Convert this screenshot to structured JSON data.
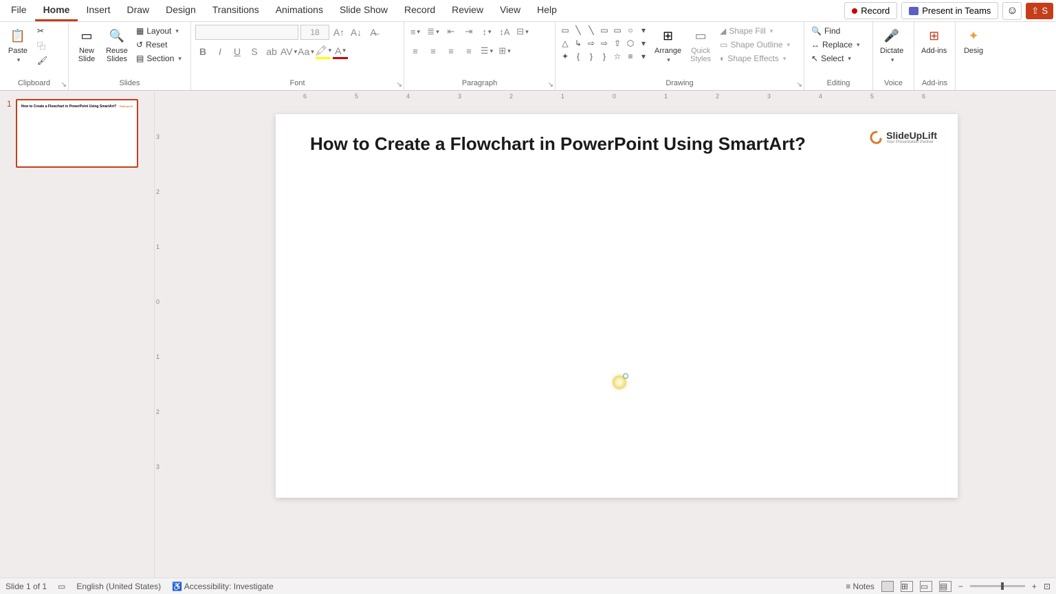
{
  "tabs": {
    "file": "File",
    "home": "Home",
    "insert": "Insert",
    "draw": "Draw",
    "design": "Design",
    "transitions": "Transitions",
    "animations": "Animations",
    "slideshow": "Slide Show",
    "record": "Record",
    "review": "Review",
    "view": "View",
    "help": "Help"
  },
  "top_right": {
    "record": "Record",
    "present": "Present in Teams",
    "share_initial": "S"
  },
  "ribbon": {
    "clipboard": {
      "paste": "Paste",
      "label": "Clipboard"
    },
    "slides": {
      "new_slide": "New\nSlide",
      "reuse": "Reuse\nSlides",
      "layout": "Layout",
      "reset": "Reset",
      "section": "Section",
      "label": "Slides"
    },
    "font": {
      "size": "18",
      "label": "Font"
    },
    "paragraph": {
      "label": "Paragraph"
    },
    "drawing": {
      "arrange": "Arrange",
      "quick": "Quick\nStyles",
      "fill": "Shape Fill",
      "outline": "Shape Outline",
      "effects": "Shape Effects",
      "label": "Drawing"
    },
    "editing": {
      "find": "Find",
      "replace": "Replace",
      "select": "Select",
      "label": "Editing"
    },
    "voice": {
      "dictate": "Dictate",
      "label": "Voice"
    },
    "addins": {
      "addins": "Add-ins",
      "label": "Add-ins"
    },
    "designer": {
      "design": "Desig"
    }
  },
  "ruler": {
    "h": [
      "6",
      "5",
      "4",
      "3",
      "2",
      "1",
      "0",
      "1",
      "2",
      "3",
      "4",
      "5",
      "6"
    ],
    "v": [
      "3",
      "2",
      "1",
      "0",
      "1",
      "2",
      "3"
    ]
  },
  "thumb": {
    "num": "1",
    "title": "How to Create a Flowchart in PowerPoint Using SmartArt?",
    "logo": "SlideUpLift"
  },
  "slide": {
    "title": "How to Create a Flowchart in PowerPoint Using SmartArt?",
    "logo_main": "SlideUpLift",
    "logo_sub": "Your Presentation Partner"
  },
  "status": {
    "slide": "Slide 1 of 1",
    "lang": "English (United States)",
    "access": "Accessibility: Investigate",
    "notes": "Notes"
  }
}
